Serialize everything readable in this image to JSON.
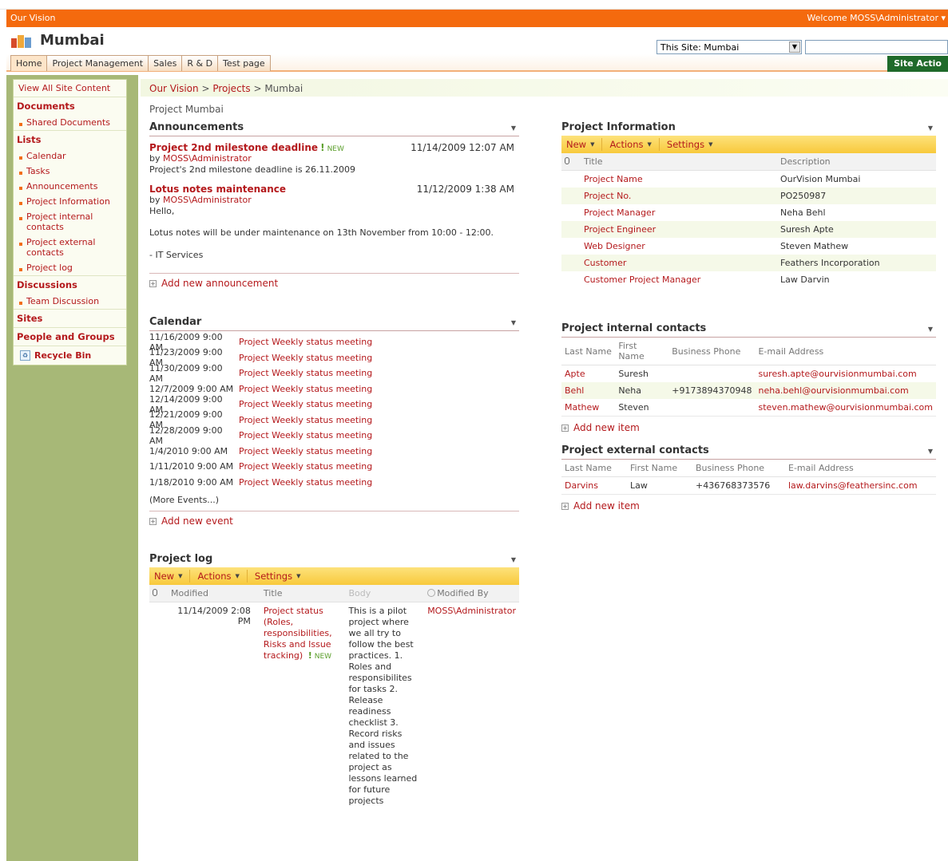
{
  "topbar": {
    "site_name": "Our Vision",
    "welcome": "Welcome MOSS\\Administrator ▾"
  },
  "header": {
    "title": "Mumbai",
    "scope_value": "This Site: Mumbai",
    "site_actions": "Site Actio"
  },
  "nav": {
    "tabs": [
      "Home",
      "Project Management",
      "Sales",
      "R & D",
      "Test page"
    ]
  },
  "quicklaunch": {
    "view_all": "View All Site Content",
    "documents": "Documents",
    "shared_documents": "Shared Documents",
    "lists": "Lists",
    "calendar": "Calendar",
    "tasks": "Tasks",
    "announcements": "Announcements",
    "project_information": "Project Information",
    "project_internal_contacts": "Project internal contacts",
    "project_external_contacts": "Project external contacts",
    "project_log": "Project log",
    "discussions": "Discussions",
    "team_discussion": "Team Discussion",
    "sites": "Sites",
    "people_groups": "People and Groups",
    "recycle_bin": "Recycle Bin"
  },
  "breadcrumb": {
    "root": "Our Vision",
    "sep": " > ",
    "mid": "Projects",
    "current": "Mumbai"
  },
  "page_title": "Project Mumbai",
  "announcements": {
    "title": "Announcements",
    "items": [
      {
        "title": "Project 2nd milestone deadline",
        "new": "NEW",
        "date": "11/14/2009 12:07 AM",
        "by": "by ",
        "author": "MOSS\\Administrator",
        "body": "Project's 2nd milestone deadline is 26.11.2009"
      },
      {
        "title": "Lotus notes maintenance",
        "date": "11/12/2009 1:38 AM",
        "by": "by ",
        "author": "MOSS\\Administrator",
        "body1": "Hello,",
        "body2": "Lotus notes will be under maintenance on 13th November from 10:00 - 12:00.",
        "body3": "- IT Services"
      }
    ],
    "add": "Add new announcement"
  },
  "calendar": {
    "title": "Calendar",
    "events": [
      {
        "date": "11/16/2009 9:00 AM",
        "title": "Project Weekly status meeting"
      },
      {
        "date": "11/23/2009 9:00 AM",
        "title": "Project Weekly status meeting"
      },
      {
        "date": "11/30/2009 9:00 AM",
        "title": "Project Weekly status meeting"
      },
      {
        "date": "12/7/2009 9:00 AM",
        "title": "Project Weekly status meeting"
      },
      {
        "date": "12/14/2009 9:00 AM",
        "title": "Project Weekly status meeting"
      },
      {
        "date": "12/21/2009 9:00 AM",
        "title": "Project Weekly status meeting"
      },
      {
        "date": "12/28/2009 9:00 AM",
        "title": "Project Weekly status meeting"
      },
      {
        "date": "1/4/2010 9:00 AM",
        "title": "Project Weekly status meeting"
      },
      {
        "date": "1/11/2010 9:00 AM",
        "title": "Project Weekly status meeting"
      },
      {
        "date": "1/18/2010 9:00 AM",
        "title": "Project Weekly status meeting"
      }
    ],
    "more": "(More Events...)",
    "add": "Add new event"
  },
  "toolbar": {
    "new": "New",
    "actions": "Actions",
    "settings": "Settings"
  },
  "project_log": {
    "title": "Project log",
    "headers": [
      "Modified",
      "Title",
      "Body",
      "Modified By"
    ],
    "row": {
      "modified": "11/14/2009 2:08 PM",
      "title": "Project status (Roles, responsibilities, Risks and Issue tracking)",
      "new": "NEW",
      "body": "This is a pilot project where we all try to follow the best practices. 1. Roles and responsibilites for tasks 2. Release readiness checklist 3. Record risks and issues related to the project as lessons learned for future projects",
      "modified_by": "MOSS\\Administrator"
    }
  },
  "project_info": {
    "title": "Project Information",
    "headers": [
      "Title",
      "Description"
    ],
    "rows": [
      {
        "title": "Project Name",
        "desc": "OurVision Mumbai"
      },
      {
        "title": "Project No.",
        "desc": "PO250987"
      },
      {
        "title": "Project Manager",
        "desc": "Neha Behl"
      },
      {
        "title": "Project Engineer",
        "desc": "Suresh Apte"
      },
      {
        "title": "Web Designer",
        "desc": "Steven Mathew"
      },
      {
        "title": "Customer",
        "desc": "Feathers Incorporation"
      },
      {
        "title": "Customer Project Manager",
        "desc": "Law Darvin"
      }
    ]
  },
  "internal_contacts": {
    "title": "Project internal contacts",
    "headers": [
      "Last Name",
      "First Name",
      "Business Phone",
      "E-mail Address"
    ],
    "rows": [
      {
        "last": "Apte",
        "first": "Suresh",
        "phone": "",
        "email": "suresh.apte@ourvisionmumbai.com"
      },
      {
        "last": "Behl",
        "first": "Neha",
        "phone": "+9173894370948",
        "email": "neha.behl@ourvisionmumbai.com"
      },
      {
        "last": "Mathew",
        "first": "Steven",
        "phone": "",
        "email": "steven.mathew@ourvisionmumbai.com"
      }
    ],
    "add": "Add new item"
  },
  "external_contacts": {
    "title": "Project external contacts",
    "headers": [
      "Last Name",
      "First Name",
      "Business Phone",
      "E-mail Address"
    ],
    "rows": [
      {
        "last": "Darvins",
        "first": "Law",
        "phone": "+436768373576",
        "email": "law.darvins@feathersinc.com"
      }
    ],
    "add": "Add new item"
  },
  "colors": {
    "accent_orange": "#f46a0e",
    "link_red": "#b4191c",
    "sidebar_green": "#a7b877",
    "toolbar_yellow": "#f8c93c"
  }
}
